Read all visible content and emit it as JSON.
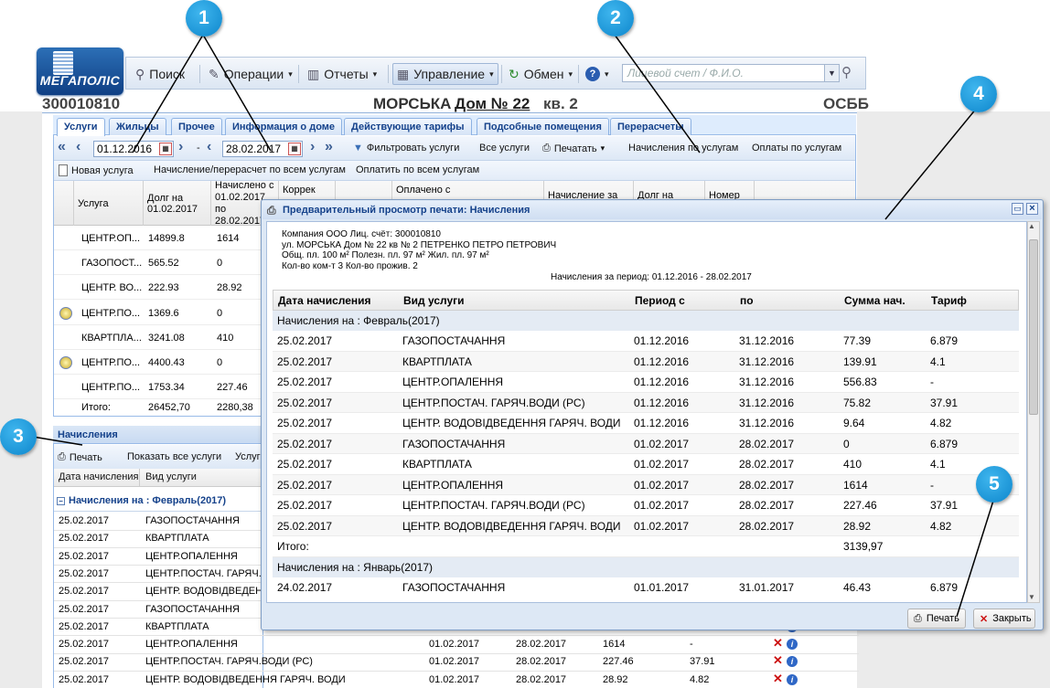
{
  "logo_text": "МЕГАПОЛІС",
  "toolbar": {
    "search": "Поиск",
    "operations": "Операции",
    "reports": "Отчеты",
    "management": "Управление",
    "exchange": "Обмен",
    "help_icon": "question-icon",
    "search_placeholder": "Лицевой счет / Ф.И.О."
  },
  "header": {
    "account": "300010810",
    "street": "МОРСЬКА",
    "house": "Дом № 22",
    "flat": "кв. 2",
    "org": "ОСББ"
  },
  "tabs": [
    "Услуги",
    "Жильцы",
    "Прочее",
    "Информация о доме",
    "Действующие тарифы",
    "Подсобные помещения",
    "Перерасчеты"
  ],
  "filter_bar": {
    "date_from": "01.12.2016",
    "dash": "-",
    "date_to": "28.02.2017",
    "filter": "Фильтровать услуги",
    "all_services": "Все услуги",
    "print": "Печатать",
    "charges_by_service": "Начисления по услугам",
    "payments_by_service": "Оплаты по услугам"
  },
  "action_bar": {
    "new_service": "Новая услуга",
    "charge_all": "Начисление/перерасчет по всем услугам",
    "pay_all": "Оплатить по всем услугам"
  },
  "services_grid": {
    "columns": [
      "Услуга",
      "Долг на 01.02.2017",
      "Начислено с 01.02.2017 по 28.02.2017",
      "Коррек",
      "Оплачено с",
      "Начисление за",
      "Долг на",
      "Номер во"
    ],
    "rows": [
      {
        "name": "ЦЕНТР.ОП...",
        "debt": "14899.8",
        "charged": "1614",
        "icon": false
      },
      {
        "name": "ГАЗОПОСТ...",
        "debt": "565.52",
        "charged": "0",
        "icon": false
      },
      {
        "name": "ЦЕНТР. ВО...",
        "debt": "222.93",
        "charged": "28.92",
        "icon": false
      },
      {
        "name": "ЦЕНТР.ПО...",
        "debt": "1369.6",
        "charged": "0",
        "icon": true
      },
      {
        "name": "КВАРТПЛА...",
        "debt": "3241.08",
        "charged": "410",
        "icon": false
      },
      {
        "name": "ЦЕНТР.ПО...",
        "debt": "4400.43",
        "charged": "0",
        "icon": true
      },
      {
        "name": "ЦЕНТР.ПО...",
        "debt": "1753.34",
        "charged": "227.46",
        "icon": false
      }
    ],
    "total_label": "Итого:",
    "total_debt": "26452,70",
    "total_charged": "2280,38"
  },
  "charges_panel": {
    "title": "Начисления",
    "print": "Печать",
    "show_all": "Показать все услуги",
    "services": "Услуга",
    "col_date": "Дата начисления",
    "col_service": "Вид услуги",
    "group": "Начисления на : Февраль(2017)",
    "rows": [
      {
        "date": "25.02.2017",
        "service": "ГАЗОПОСТАЧАННЯ",
        "from": "",
        "to": "",
        "sum": "",
        "tariff": ""
      },
      {
        "date": "25.02.2017",
        "service": "КВАРТПЛАТА",
        "from": "",
        "to": "",
        "sum": "",
        "tariff": ""
      },
      {
        "date": "25.02.2017",
        "service": "ЦЕНТР.ОПАЛЕННЯ",
        "from": "",
        "to": "",
        "sum": "",
        "tariff": ""
      },
      {
        "date": "25.02.2017",
        "service": "ЦЕНТР.ПОСТАЧ. ГАРЯЧ.ВО",
        "from": "",
        "to": "",
        "sum": "",
        "tariff": ""
      },
      {
        "date": "25.02.2017",
        "service": "ЦЕНТР. ВОДОВІДВЕДЕННЯ",
        "from": "",
        "to": "",
        "sum": "",
        "tariff": ""
      },
      {
        "date": "25.02.2017",
        "service": "ГАЗОПОСТАЧАННЯ",
        "from": "",
        "to": "",
        "sum": "",
        "tariff": ""
      },
      {
        "date": "25.02.2017",
        "service": "КВАРТПЛАТА",
        "from": "",
        "to": "",
        "sum": "",
        "tariff": ""
      },
      {
        "date": "25.02.2017",
        "service": "ЦЕНТР.ОПАЛЕННЯ",
        "from": "01.02.2017",
        "to": "28.02.2017",
        "sum": "1614",
        "tariff": "-"
      },
      {
        "date": "25.02.2017",
        "service": "ЦЕНТР.ПОСТАЧ. ГАРЯЧ.ВОДИ (РС)",
        "from": "01.02.2017",
        "to": "28.02.2017",
        "sum": "227.46",
        "tariff": "37.91"
      },
      {
        "date": "25.02.2017",
        "service": "ЦЕНТР. ВОДОВІДВЕДЕННЯ ГАРЯЧ. ВОДИ",
        "from": "01.02.2017",
        "to": "28.02.2017",
        "sum": "28.92",
        "tariff": "4.82"
      }
    ]
  },
  "modal": {
    "title": "Предварительный просмотр печати: Начисления",
    "info_lines": [
      "Компания ООО  Лиц. счёт: 300010810",
      "ул. МОРСЬКА Дом № 22 кв № 2  ПЕТРЕНКО ПЕТРО ПЕТРОВИЧ",
      "Общ. пл. 100 м²  Полезн. пл. 97 м²  Жил. пл. 97 м²",
      "Кол-во ком-т 3  Кол-во прожив. 2"
    ],
    "period": "Начисления за период: 01.12.2016 - 28.02.2017",
    "columns": [
      "Дата начисления",
      "Вид услуги",
      "Период с",
      "по",
      "Сумма нач.",
      "Тариф"
    ],
    "group1": "Начисления на : Февраль(2017)",
    "rows": [
      [
        "25.02.2017",
        "ГАЗОПОСТАЧАННЯ",
        "01.12.2016",
        "31.12.2016",
        "77.39",
        "6.879"
      ],
      [
        "25.02.2017",
        "КВАРТПЛАТА",
        "01.12.2016",
        "31.12.2016",
        "139.91",
        "4.1"
      ],
      [
        "25.02.2017",
        "ЦЕНТР.ОПАЛЕННЯ",
        "01.12.2016",
        "31.12.2016",
        "556.83",
        "-"
      ],
      [
        "25.02.2017",
        "ЦЕНТР.ПОСТАЧ. ГАРЯЧ.ВОДИ (РС)",
        "01.12.2016",
        "31.12.2016",
        "75.82",
        "37.91"
      ],
      [
        "25.02.2017",
        "ЦЕНТР. ВОДОВІДВЕДЕННЯ ГАРЯЧ. ВОДИ",
        "01.12.2016",
        "31.12.2016",
        "9.64",
        "4.82"
      ],
      [
        "25.02.2017",
        "ГАЗОПОСТАЧАННЯ",
        "01.02.2017",
        "28.02.2017",
        "0",
        "6.879"
      ],
      [
        "25.02.2017",
        "КВАРТПЛАТА",
        "01.02.2017",
        "28.02.2017",
        "410",
        "4.1"
      ],
      [
        "25.02.2017",
        "ЦЕНТР.ОПАЛЕННЯ",
        "01.02.2017",
        "28.02.2017",
        "1614",
        "-"
      ],
      [
        "25.02.2017",
        "ЦЕНТР.ПОСТАЧ. ГАРЯЧ.ВОДИ (РС)",
        "01.02.2017",
        "28.02.2017",
        "227.46",
        "37.91"
      ],
      [
        "25.02.2017",
        "ЦЕНТР. ВОДОВІДВЕДЕННЯ ГАРЯЧ. ВОДИ",
        "01.02.2017",
        "28.02.2017",
        "28.92",
        "4.82"
      ]
    ],
    "total_label": "Итого:",
    "total_value": "3139,97",
    "group2": "Начисления на : Январь(2017)",
    "row2": [
      "24.02.2017",
      "ГАЗОПОСТАЧАННЯ",
      "01.01.2017",
      "31.01.2017",
      "46.43",
      "6.879"
    ],
    "print_btn": "Печать",
    "close_btn": "Закрыть"
  },
  "callouts": [
    "1",
    "2",
    "3",
    "4",
    "5"
  ],
  "colors": {
    "accent": "#15428b",
    "callout": "#1a9ee0",
    "border": "#99bbe8"
  }
}
